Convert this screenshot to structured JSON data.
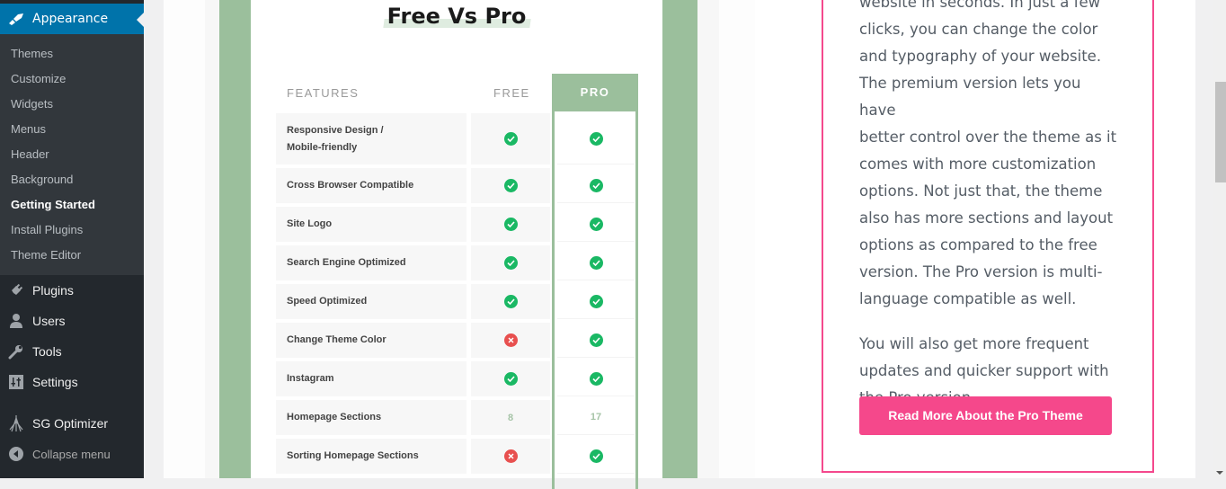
{
  "sidebar": {
    "active_menu": {
      "label": "Appearance",
      "icon": "paintbrush-icon"
    },
    "submenu": [
      {
        "label": "Themes",
        "current": false
      },
      {
        "label": "Customize",
        "current": false
      },
      {
        "label": "Widgets",
        "current": false
      },
      {
        "label": "Menus",
        "current": false
      },
      {
        "label": "Header",
        "current": false
      },
      {
        "label": "Background",
        "current": false
      },
      {
        "label": "Getting Started",
        "current": true
      },
      {
        "label": "Install Plugins",
        "current": false
      },
      {
        "label": "Theme Editor",
        "current": false
      }
    ],
    "items": [
      {
        "label": "Plugins",
        "icon": "plugin-icon"
      },
      {
        "label": "Users",
        "icon": "user-icon"
      },
      {
        "label": "Tools",
        "icon": "wrench-icon"
      },
      {
        "label": "Settings",
        "icon": "settings-sliders-icon"
      },
      {
        "label": "SG Optimizer",
        "icon": "sg-optimizer-icon"
      }
    ],
    "collapse_label": "Collapse menu"
  },
  "comparison": {
    "title": "Free Vs Pro",
    "headers": {
      "features": "FEATURES",
      "free": "FREE",
      "pro": "PRO"
    },
    "rows": [
      {
        "feature_line1": "Responsive Design /",
        "feature_line2": "Mobile-friendly",
        "free": "check",
        "pro": "check"
      },
      {
        "feature_line1": "Cross Browser Compatible",
        "free": "check",
        "pro": "check"
      },
      {
        "feature_line1": "Site Logo",
        "free": "check",
        "pro": "check"
      },
      {
        "feature_line1": "Search Engine Optimized",
        "free": "check",
        "pro": "check"
      },
      {
        "feature_line1": "Speed Optimized",
        "free": "check",
        "pro": "check"
      },
      {
        "feature_line1": "Change Theme Color",
        "free": "cross",
        "pro": "check"
      },
      {
        "feature_line1": "Instagram",
        "free": "check",
        "pro": "check"
      },
      {
        "feature_line1": "Homepage Sections",
        "free": "8",
        "pro": "17"
      },
      {
        "feature_line1": "Sorting Homepage Sections",
        "free": "cross",
        "pro": "check"
      }
    ]
  },
  "pro_panel": {
    "paragraph1_lines": [
      "website in seconds. In just a few",
      "clicks, you can change the color",
      "and typography of your website.",
      "The premium version lets you have",
      "better control over the theme as it",
      "comes with more customization",
      "options. Not just that, the theme",
      "also has more sections and layout",
      "options as compared to the free",
      "version. The Pro version is multi-",
      "language compatible as well."
    ],
    "paragraph2_lines": [
      "You will also get more frequent",
      "updates and quicker support with",
      "the Pro version."
    ],
    "button_label": "Read More About the Pro Theme"
  },
  "colors": {
    "admin_accent": "#0073aa",
    "sage_green": "#9bbf9c",
    "check_green": "#1ab864",
    "cross_red": "#e8504f",
    "pink_accent": "#f5488b"
  }
}
